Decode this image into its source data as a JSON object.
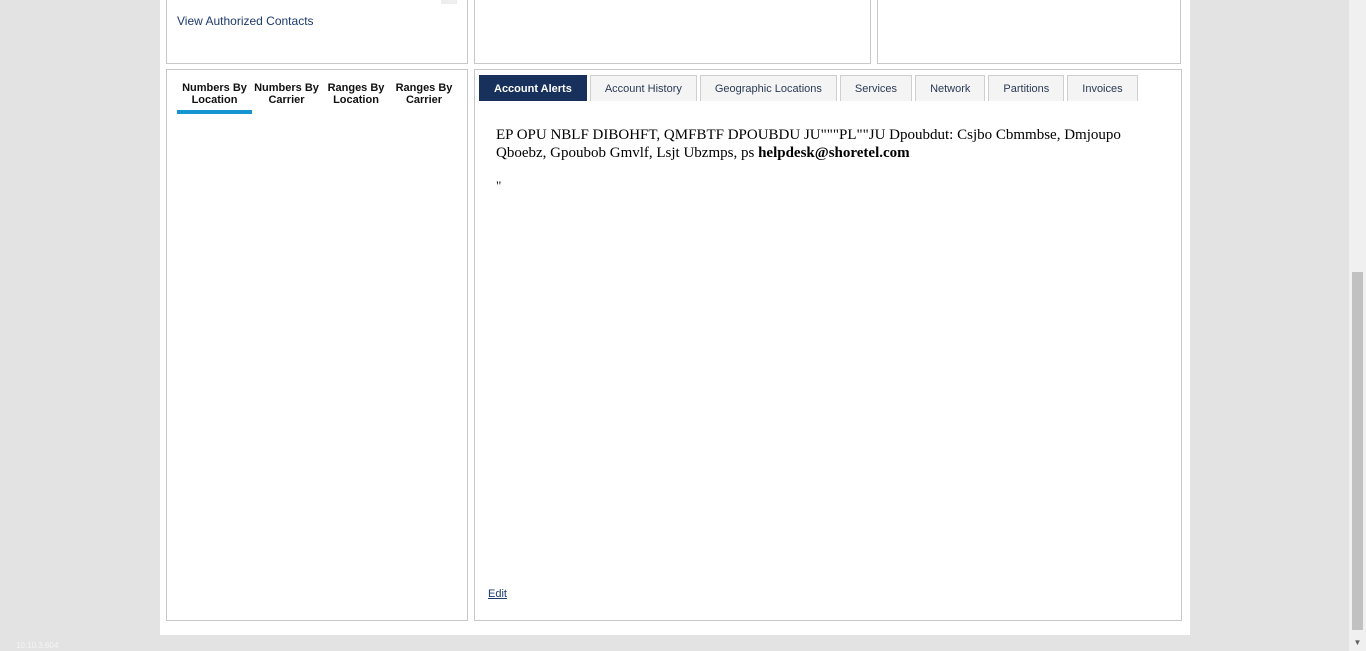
{
  "contacts_panel": {
    "view_contacts_label": "View Authorized Contacts"
  },
  "number_tabs": [
    {
      "label": "Numbers By Location",
      "active": true
    },
    {
      "label": "Numbers By Carrier",
      "active": false
    },
    {
      "label": "Ranges By Location",
      "active": false
    },
    {
      "label": "Ranges By Carrier",
      "active": false
    }
  ],
  "main_tabs": [
    {
      "label": "Account Alerts",
      "active": true
    },
    {
      "label": "Account History",
      "active": false
    },
    {
      "label": "Geographic Locations",
      "active": false
    },
    {
      "label": "Services",
      "active": false
    },
    {
      "label": "Network",
      "active": false
    },
    {
      "label": "Partitions",
      "active": false
    },
    {
      "label": "Invoices",
      "active": false
    }
  ],
  "alert": {
    "text": "EP OPU NBLF DIBOHFT, QMFBTF DPOUBDU JU\"\"\"PL\"\"JU Dpoubdut: Csjbo Cbmmbse, Dmjoupo Qboebz, Gpoubob Gmvlf, Lsjt Ubzmps, ps ",
    "email": "helpdesk@shoretel.com",
    "quote_line": "\""
  },
  "edit_label": "Edit",
  "footer": {
    "ip": "10.10.3.604"
  },
  "colors": {
    "active_tab_bg": "#17305c",
    "active_subtab_underline": "#1594d2",
    "link": "#1c3a6e"
  }
}
